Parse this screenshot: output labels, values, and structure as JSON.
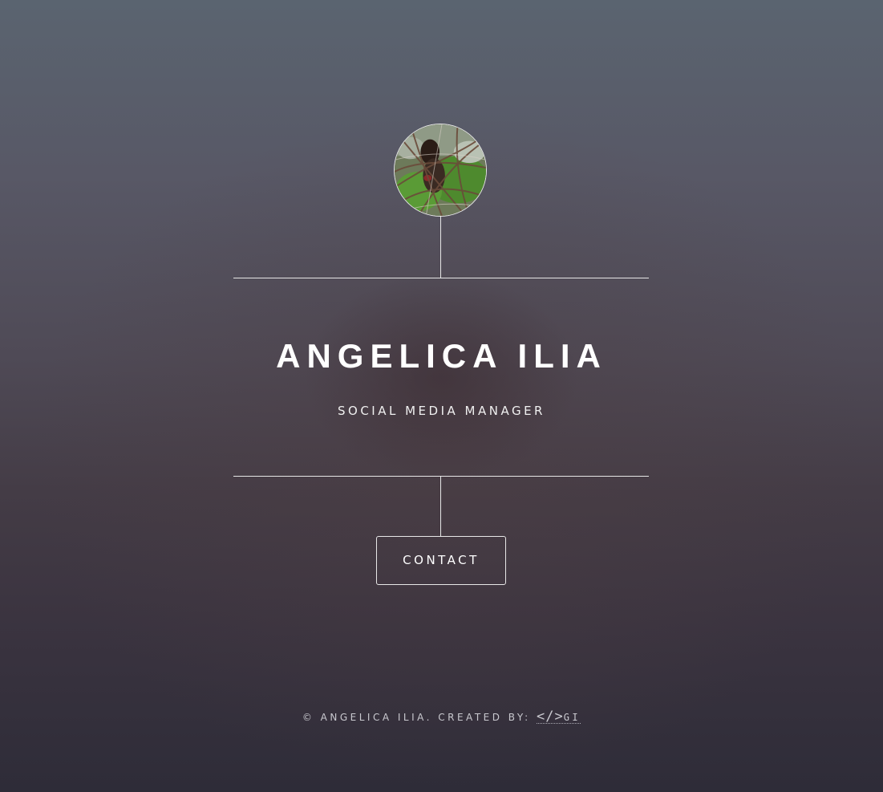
{
  "profile": {
    "avatar_alt": "profile photo",
    "name": "ANGELICA ILIA",
    "role": "SOCIAL MEDIA MANAGER"
  },
  "actions": {
    "contact_label": "CONTACT"
  },
  "footer": {
    "copyright_text": "© ANGELICA ILIA. CREATED BY:",
    "credit_mark": "</>",
    "credit_initials": "GI"
  },
  "colors": {
    "line": "#e6e6e6",
    "text": "#ffffff"
  }
}
